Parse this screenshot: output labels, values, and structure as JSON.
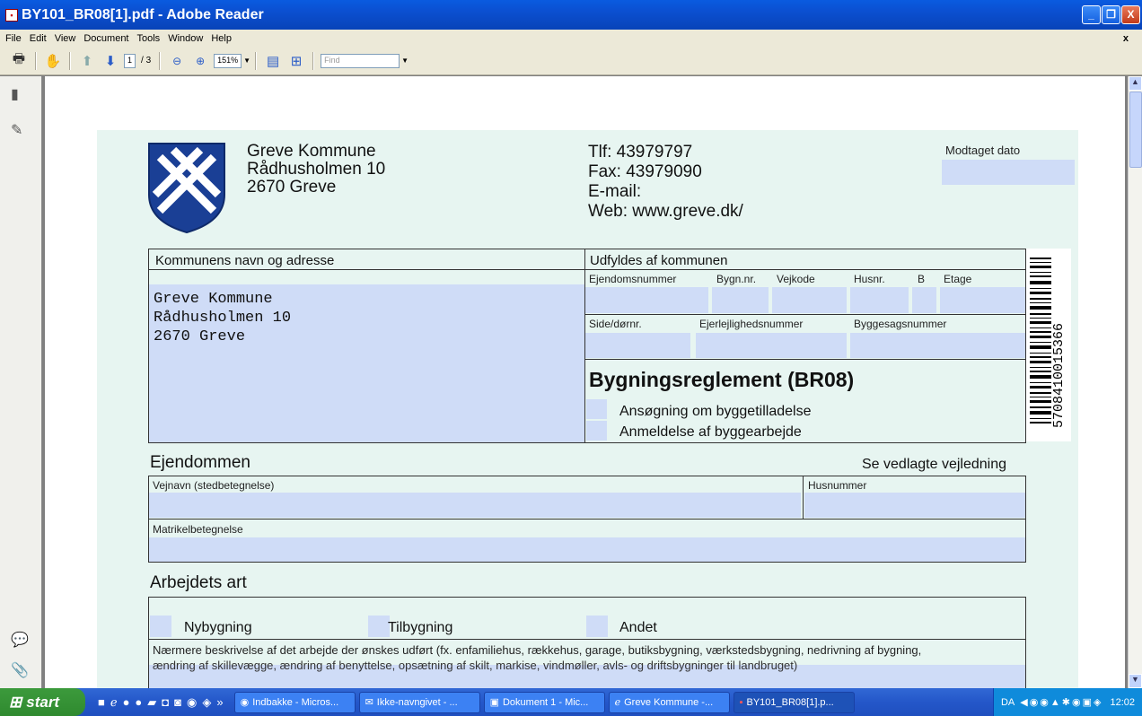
{
  "window": {
    "title": "BY101_BR08[1].pdf - Adobe Reader",
    "min": "_",
    "max": "❐",
    "close": "X"
  },
  "menu": [
    "File",
    "Edit",
    "View",
    "Document",
    "Tools",
    "Window",
    "Help"
  ],
  "menu_close": "x",
  "toolbar": {
    "page_current": "1",
    "page_total": "/ 3",
    "zoom": "151%",
    "find_placeholder": "Find"
  },
  "form": {
    "org_name": "Greve Kommune",
    "org_street": "Rådhusholmen 10",
    "org_city": "2670 Greve",
    "tlf": "Tlf: 43979797",
    "fax": "Fax: 43979090",
    "email": "E-mail:",
    "web": "Web: www.greve.dk/",
    "received_date": "Modtaget dato",
    "kommune_header": "Kommunens navn og adresse",
    "kommune_address": [
      "Greve Kommune",
      "Rådhusholmen 10",
      "2670 Greve"
    ],
    "udfyldes": "Udfyldes af kommunen",
    "col_labels": [
      "Ejendomsnummer",
      "Bygn.nr.",
      "Vejkode",
      "Husnr.",
      "B",
      "Etage"
    ],
    "row2_labels": [
      "Side/dørnr.",
      "Ejerlejlighedsnummer",
      "Byggesagsnummer"
    ],
    "regulation_title": "Bygningsreglement (BR08)",
    "option1": "Ansøgning om byggetilladelse",
    "option2": "Anmeldelse af byggearbejde",
    "barcode_number": "5708410015366",
    "ejendommen": "Ejendommen",
    "vejledning": "Se vedlagte vejledning",
    "vejnavn": "Vejnavn (stedbetegnelse)",
    "husnummer": "Husnummer",
    "matrikel": "Matrikelbetegnelse",
    "arbejdets_art": "Arbejdets art",
    "nybygning": "Nybygning",
    "tilbygning": "Tilbygning",
    "andet": "Andet",
    "beskrivelse": "Nærmere beskrivelse af det arbejde der ønskes udført (fx. enfamiliehus, rækkehus, garage, butiksbygning, værkstedsbygning, nedrivning af bygning,",
    "beskrivelse2": "ændring af skillevægge, ændring af benyttelse, opsætning af skilt, markise, vindmøller, avls- og driftsbygninger til landbruget)"
  },
  "taskbar": {
    "start": "start",
    "buttons": [
      "Indbakke - Micros...",
      "Ikke-navngivet - ...",
      "Dokument 1 - Mic...",
      "Greve Kommune -...",
      "BY101_BR08[1].p..."
    ],
    "tray_text": "DA",
    "clock": "12:02"
  },
  "colors": {
    "form_bg": "#e7f5f1",
    "field_bg": "#cfdcf7",
    "titlebar": "#0b4fd0",
    "shield": "#1a3f95"
  }
}
